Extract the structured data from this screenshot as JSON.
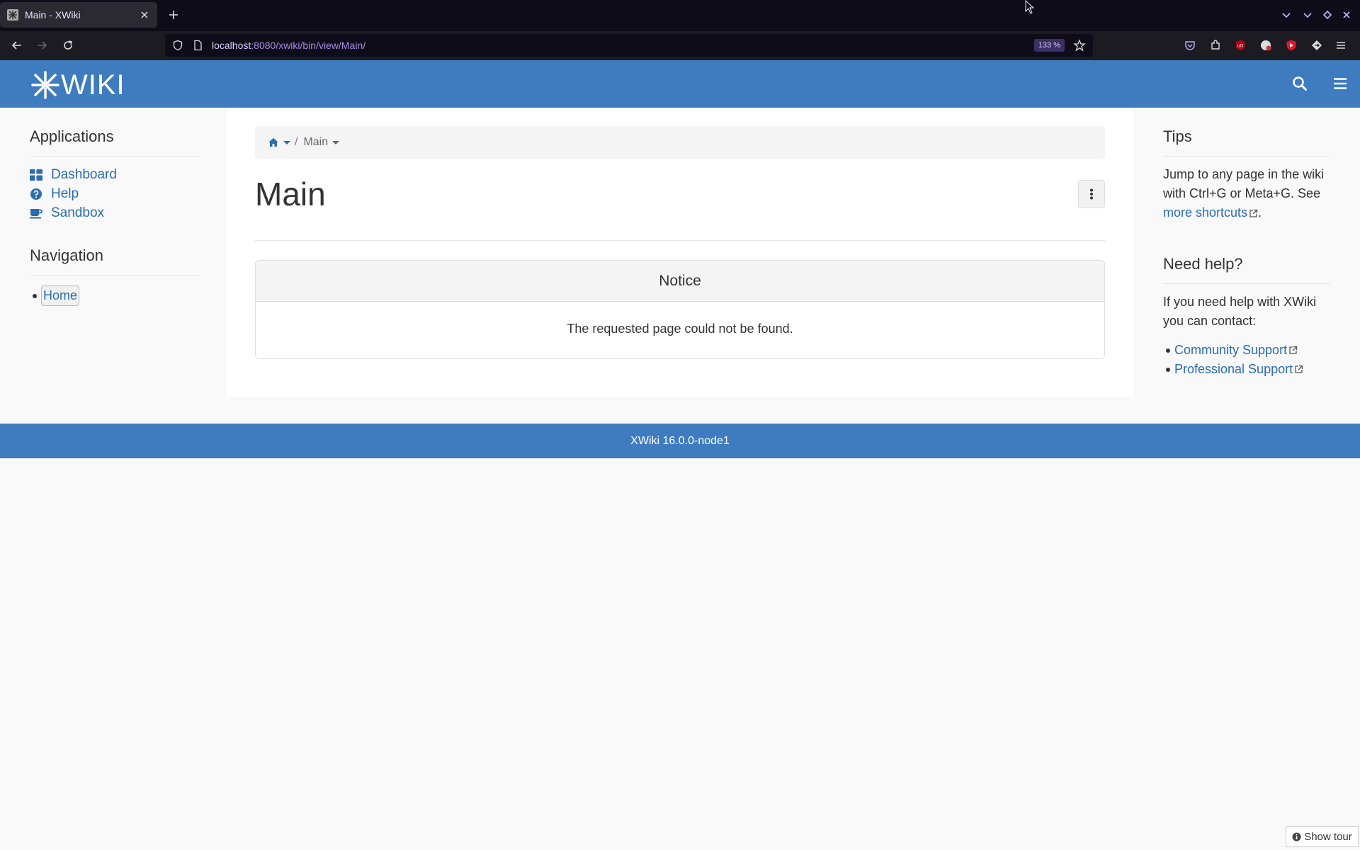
{
  "browser": {
    "tab_title": "Main - XWiki",
    "url_host": "localhost",
    "url_rest": ":8080/xwiki/bin/view/Main/",
    "zoom": "133 %"
  },
  "header": {
    "logo_text": "WIKI",
    "brand_color": "#3e7cbf"
  },
  "left_panel": {
    "applications_title": "Applications",
    "applications": [
      {
        "label": "Dashboard",
        "icon": "dashboard-icon"
      },
      {
        "label": "Help",
        "icon": "question-circle-icon"
      },
      {
        "label": "Sandbox",
        "icon": "coffee-icon"
      }
    ],
    "navigation_title": "Navigation",
    "navigation_items": [
      {
        "label": "Home"
      }
    ]
  },
  "main": {
    "breadcrumb_current": "Main",
    "page_title": "Main",
    "notice_title": "Notice",
    "notice_message": "The requested page could not be found."
  },
  "right_panel": {
    "tips_title": "Tips",
    "tips_text_1": "Jump to any page in the wiki with Ctrl+G or Meta+G. See ",
    "tips_link": "more shortcuts",
    "tips_text_2": ".",
    "help_title": "Need help?",
    "help_text": "If you need help with XWiki you can contact:",
    "help_links": [
      "Community Support",
      "Professional Support"
    ]
  },
  "footer": {
    "version": "XWiki 16.0.0-node1"
  },
  "tour_button": "Show tour"
}
